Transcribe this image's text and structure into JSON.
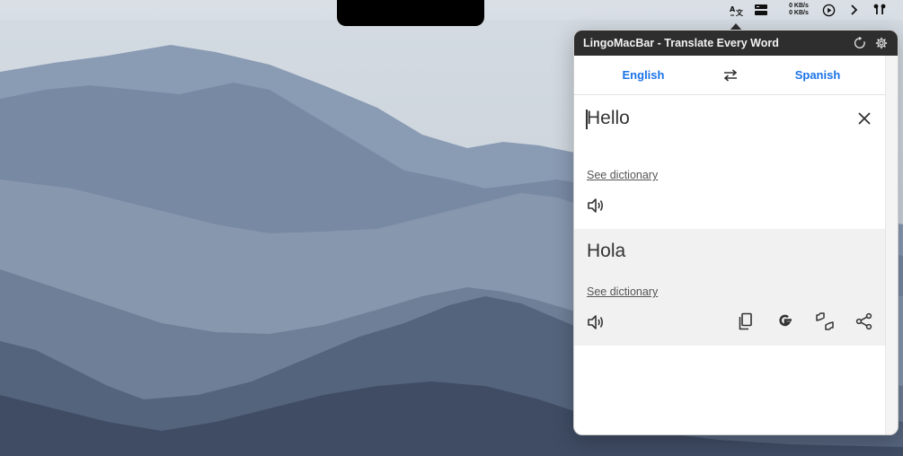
{
  "menubar": {
    "net_up": "0 KB/s",
    "net_down": "0 KB/s",
    "icons": [
      "translate-icon",
      "storage-icon",
      "play-circle-icon",
      "chevron-right-icon",
      "airpods-icon"
    ]
  },
  "popup": {
    "title": "LingoMacBar - Translate Every Word",
    "titlebar_icons": [
      "reload-icon",
      "gear-icon"
    ],
    "languages": {
      "source": "English",
      "target": "Spanish"
    },
    "source": {
      "text": "Hello",
      "dictionary_link": "See dictionary"
    },
    "translation": {
      "text": "Hola",
      "dictionary_link": "See dictionary",
      "actions": [
        "copy-icon",
        "google-icon",
        "feedback-icon",
        "share-icon"
      ]
    }
  },
  "colors": {
    "accent": "#1a73e8",
    "titlebar": "#2e2e2e",
    "translation_bg": "#f1f1f1"
  }
}
